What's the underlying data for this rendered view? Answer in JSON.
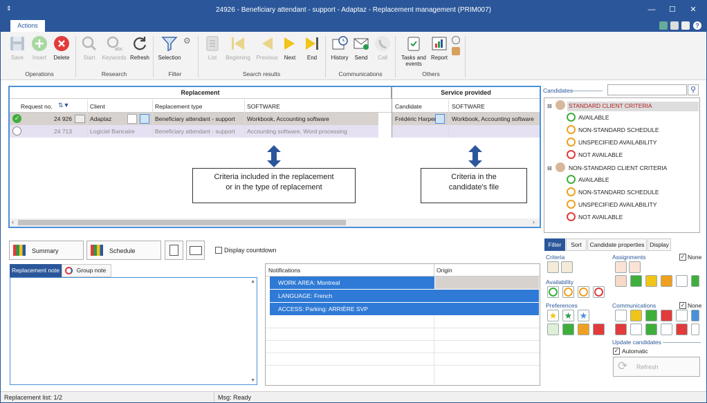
{
  "window": {
    "title": "24926 - Beneficiary attendant - support - Adaptaz - Replacement management (PRIM007)",
    "system_menu": "⇕"
  },
  "ribbon_tab": "Actions",
  "ribbon": {
    "operations": {
      "label": "Operations",
      "save": "Save",
      "insert": "Insert",
      "delete": "Delete"
    },
    "research": {
      "label": "Research",
      "start": "Start",
      "keywords": "Keywords",
      "refresh": "Refresh"
    },
    "filter": {
      "label": "Filter",
      "selection": "Selection"
    },
    "search_results": {
      "label": "Search results",
      "list": "List",
      "beginning": "Beginning",
      "previous": "Previous",
      "next": "Next",
      "end": "End"
    },
    "communications": {
      "label": "Communications",
      "history": "History",
      "send": "Send",
      "call": "Call"
    },
    "others": {
      "label": "Others",
      "tasks_line1": "Tasks and",
      "tasks_line2": "events",
      "report": "Report"
    }
  },
  "replacement": {
    "section": "Replacement",
    "service_section": "Service provided",
    "headers": {
      "request": "Request no.",
      "client": "Client",
      "type": "Replacement type",
      "software": "SOFTWARE",
      "candidate": "Candidate",
      "software2": "SOFTWARE"
    },
    "rows": [
      {
        "request": "24 926",
        "client": "Adaptaz",
        "type": "Beneficiary attendant - support",
        "software": "Workbook, Accounting software",
        "candidate": "Frédéric Harper",
        "software2": "Workbook, Accounting software"
      },
      {
        "request": "24 713",
        "client": "Logiciel Bancaire",
        "type": "Beneficiary attendant - support",
        "software": "Accounting software, Word processing",
        "candidate": "",
        "software2": ""
      }
    ]
  },
  "callouts": {
    "left_line1": "Criteria included in the replacement",
    "left_line2": "or in the type of replacement",
    "right_line1": "Criteria in the",
    "right_line2": "candidate's file"
  },
  "buttons": {
    "summary": "Summary",
    "schedule": "Schedule",
    "countdown": "Display countdown"
  },
  "notes": {
    "replacement": "Replacement note",
    "group": "Group note"
  },
  "notifications": {
    "header": "Notifications",
    "origin": "Origin",
    "items": [
      "WORK AREA: Montreal",
      "LANGUAGE: French",
      "ACCESS: Parking: ARRIÈRE SVP"
    ]
  },
  "candidates": {
    "label": "Candidates",
    "groups": [
      {
        "name": "STANDARD CLIENT CRITERIA",
        "items": [
          "AVAILABLE",
          "NON-STANDARD SCHEDULE",
          "UNSPECIFIED AVAILABILITY",
          "NOT AVAILABLE"
        ]
      },
      {
        "name": "NON-STANDARD CLIENT CRITERIA",
        "items": [
          "AVAILABLE",
          "NON-STANDARD SCHEDULE",
          "UNSPECIFIED AVAILABILITY",
          "NOT AVAILABLE"
        ]
      }
    ]
  },
  "filter_tabs": [
    "Filter",
    "Sort",
    "Candidate properties",
    "Display"
  ],
  "filter": {
    "criteria": "Criteria",
    "assignments": "Assignments",
    "none1": "None",
    "availability": "Availability",
    "preferences": "Preferences",
    "communications": "Communications",
    "none2": "None",
    "update": "Update candidates",
    "automatic": "Automatic",
    "refresh": "Refresh"
  },
  "status": {
    "list": "Replacement list: 1/2",
    "msg": "Msg: Ready"
  },
  "colors": {
    "accent": "#2b579a",
    "selected_row": "#d8d2cf",
    "alt_row": "#e6e1f2",
    "notif_blue": "#2f7ad6"
  }
}
